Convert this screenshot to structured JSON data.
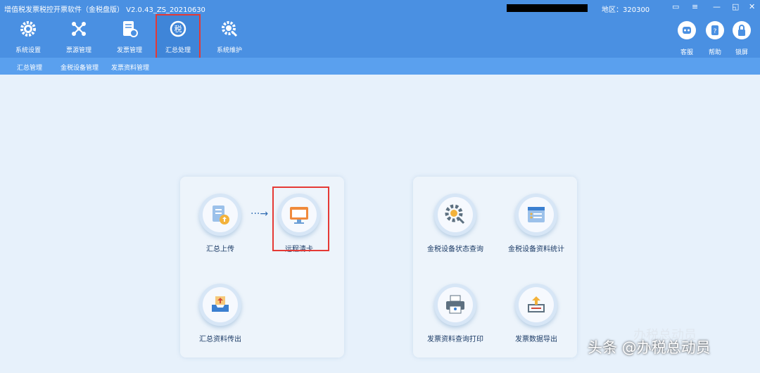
{
  "window": {
    "title": "增值税发票税控开票软件（金税盘版） V2.0.43_ZS_20210630",
    "region": "地区：320300",
    "controls": [
      "▭",
      "≡",
      "—",
      "◱",
      "✕"
    ]
  },
  "toolbar": {
    "items": [
      {
        "label": "系统设置",
        "icon": "gear-icon"
      },
      {
        "label": "票源管理",
        "icon": "network-icon"
      },
      {
        "label": "发票管理",
        "icon": "invoice-icon"
      },
      {
        "label": "汇总处理",
        "icon": "tax-summary-icon",
        "active": true
      },
      {
        "label": "系统维护",
        "icon": "maintenance-icon"
      }
    ],
    "right": [
      {
        "label": "客服",
        "icon": "robot-icon"
      },
      {
        "label": "帮助",
        "icon": "help-icon"
      },
      {
        "label": "锁屏",
        "icon": "lock-icon"
      }
    ]
  },
  "subnav": [
    "汇总管理",
    "金税设备管理",
    "发票资料管理"
  ],
  "left_panel": {
    "cards": [
      {
        "label": "汇总上传",
        "icon": "upload-document-icon"
      },
      {
        "label": "远程清卡",
        "icon": "remote-monitor-icon",
        "highlighted": true
      },
      {
        "label": "汇总资料传出",
        "icon": "export-tray-icon"
      }
    ],
    "arrow": "···→"
  },
  "right_panel": {
    "cards": [
      {
        "label": "金税设备状态查询",
        "icon": "gear-search-icon"
      },
      {
        "label": "金税设备资料统计",
        "icon": "calendar-list-icon"
      },
      {
        "label": "发票资料查询打印",
        "icon": "printer-icon"
      },
      {
        "label": "发票数据导出",
        "icon": "export-upload-icon"
      }
    ]
  },
  "watermark": {
    "main": "头条 @办税总动员",
    "secondary": "办税总动员"
  },
  "colors": {
    "header": "#4a90e2",
    "subnav": "#5aa0ee",
    "background": "#e7f1fb",
    "highlight": "#e53935"
  }
}
